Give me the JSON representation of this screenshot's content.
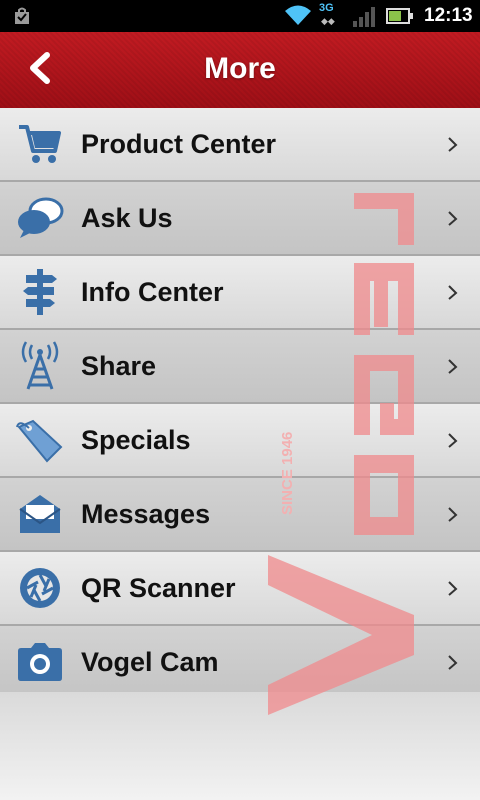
{
  "status_bar": {
    "network": "3G",
    "time": "12:13"
  },
  "header": {
    "title": "More"
  },
  "watermark": {
    "brand": "VOGEL",
    "tagline": "SINCE 1946"
  },
  "menu": {
    "items": [
      {
        "label": "Product Center",
        "icon": "shopping-cart-icon"
      },
      {
        "label": "Ask Us",
        "icon": "chat-bubbles-icon"
      },
      {
        "label": "Info Center",
        "icon": "signpost-icon"
      },
      {
        "label": "Share",
        "icon": "broadcast-tower-icon"
      },
      {
        "label": "Specials",
        "icon": "price-tag-icon"
      },
      {
        "label": "Messages",
        "icon": "envelope-icon"
      },
      {
        "label": "QR Scanner",
        "icon": "camera-aperture-icon"
      },
      {
        "label": "Vogel Cam",
        "icon": "camera-icon"
      }
    ]
  },
  "colors": {
    "header_red": "#b5151c",
    "icon_blue": "#3a6fa8",
    "watermark_red": "#f08a8c"
  }
}
